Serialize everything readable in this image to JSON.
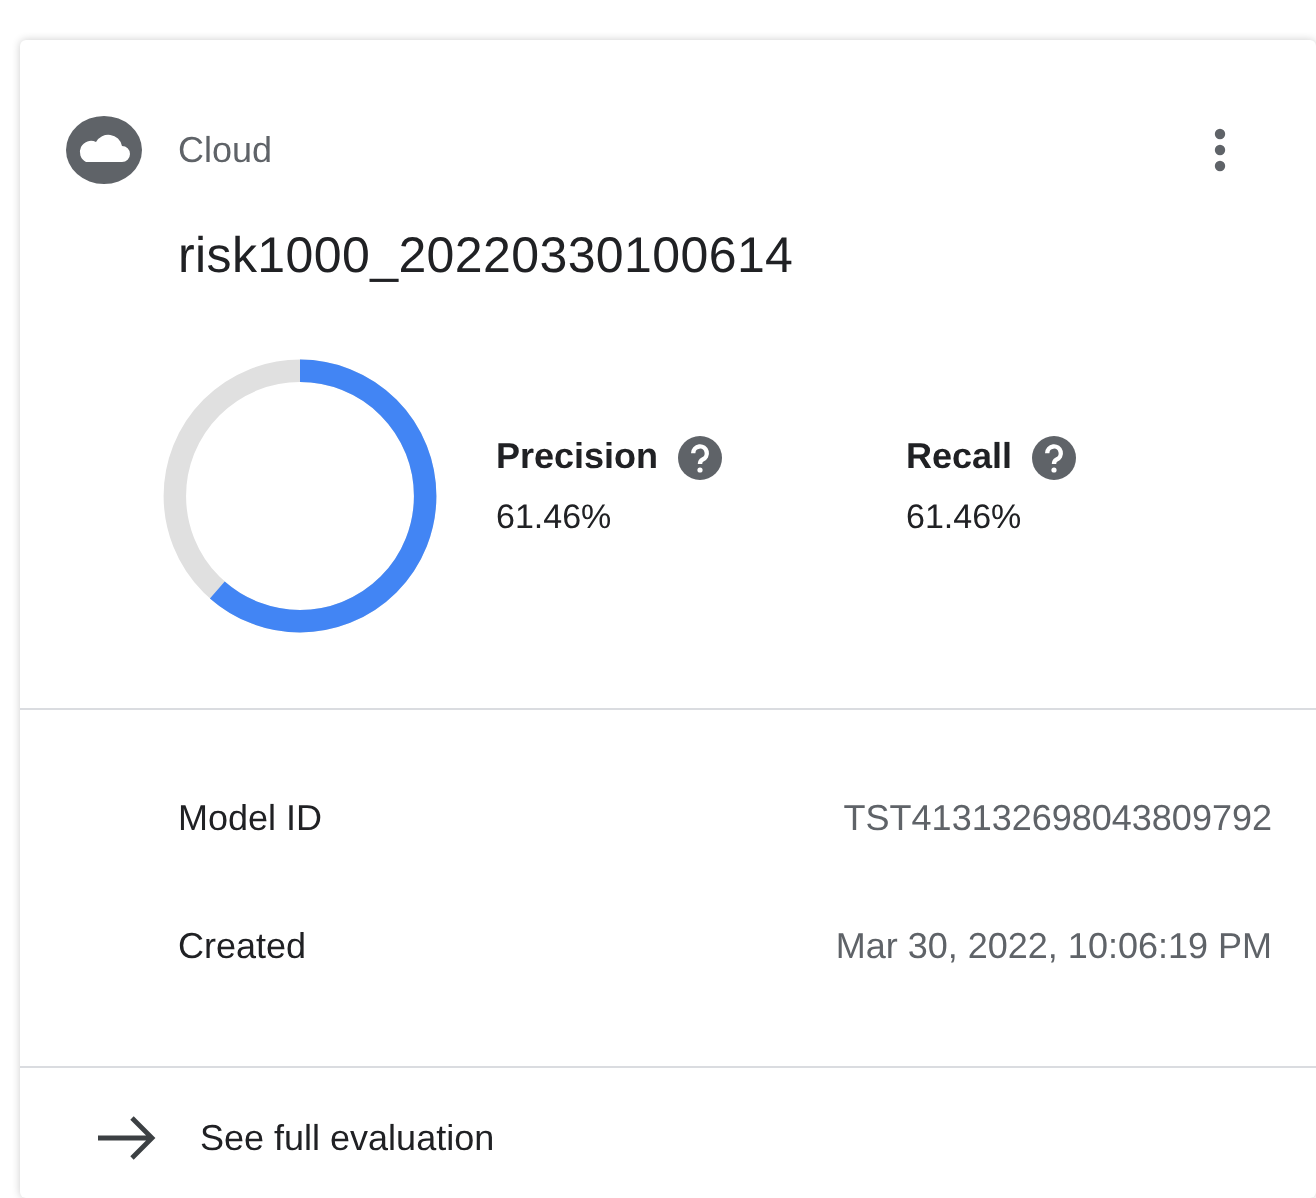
{
  "card": {
    "source": "Cloud",
    "title": "risk1000_20220330100614",
    "progress": {
      "level": 0.6146
    },
    "metrics": [
      {
        "label": "Precision",
        "value": "61.46%"
      },
      {
        "label": "Recall",
        "value": "61.46%"
      }
    ],
    "details": [
      {
        "label": "Model ID",
        "value": "TST413132698043809792"
      },
      {
        "label": "Created",
        "value": "Mar 30, 2022, 10:06:19 PM"
      }
    ],
    "link": "See full evaluation"
  }
}
